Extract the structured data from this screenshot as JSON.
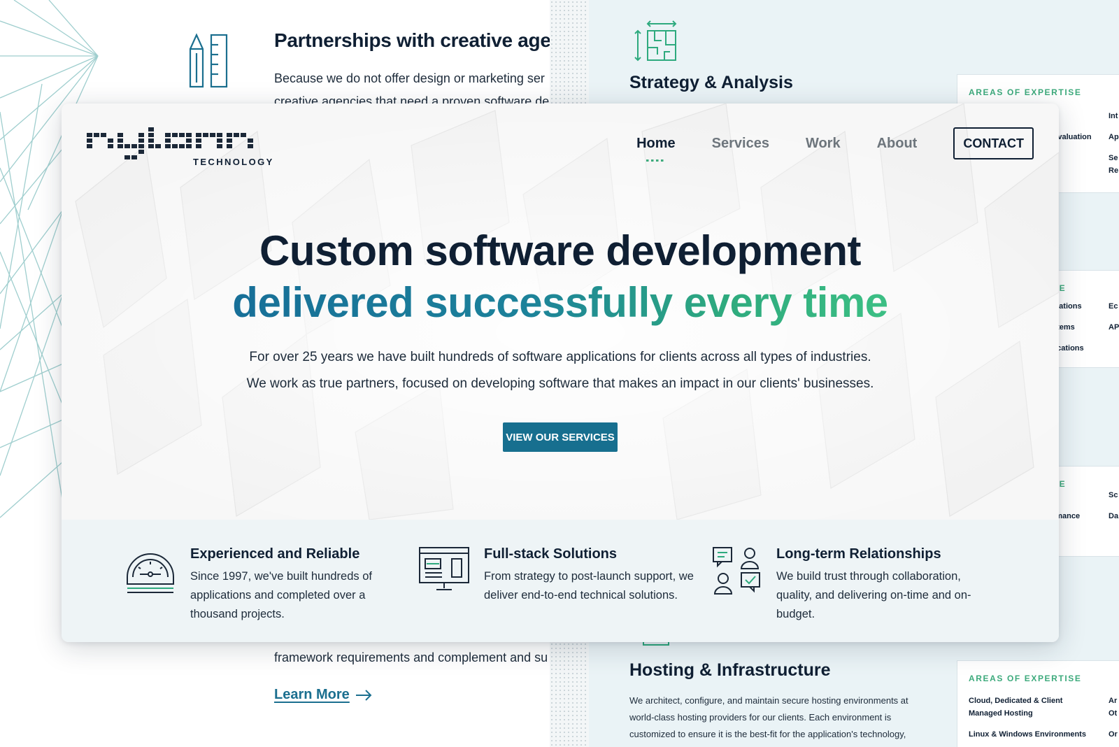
{
  "background_left": {
    "partner_title": "Partnerships with creative agen",
    "partner_text_1": "Because we do not offer design or marketing ser",
    "partner_text_2": "creative agencies that need a proven software de",
    "framework_text": "framework requirements and complement and su",
    "learn_more": "Learn More"
  },
  "background_right": {
    "strategy_title": "Strategy & Analysis",
    "hosting_title": "Hosting & Infrastructure",
    "hosting_text": "We architect, configure, and maintain secure hosting environments at world-class hosting providers for our clients. Each environment is customized to ensure it is the best-fit for the application's technology,",
    "cards": [
      {
        "label": "AREAS OF EXPERTISE",
        "items": [
          "Evaluation",
          "Int",
          "Ap",
          "Se",
          "Re"
        ]
      },
      {
        "label": "SE",
        "items": [
          "ications",
          "stems",
          "lications",
          "Ec",
          "AP"
        ]
      },
      {
        "label": "SE",
        "items": [
          "rmance",
          "Sc",
          "Da"
        ]
      },
      {
        "label": "AREAS OF EXPERTISE",
        "items": [
          "Cloud, Dedicated & Client",
          "Managed Hosting",
          "Linux & Windows Environments",
          "Ar",
          "Ot",
          "Or"
        ]
      }
    ]
  },
  "header": {
    "logo_sub": "TECHNOLOGY",
    "nav": [
      "Home",
      "Services",
      "Work",
      "About"
    ],
    "active_nav": "Home",
    "contact": "CONTACT"
  },
  "hero": {
    "headline_1": "Custom software development",
    "headline_2": "delivered successfully every time",
    "intro_1": "For over 25 years we have built hundreds of software applications for clients across all types of industries.",
    "intro_2": "We work as true partners, focused on developing software that makes an impact in our clients' businesses.",
    "cta": "VIEW OUR SERVICES"
  },
  "features": [
    {
      "icon": "gauge-icon",
      "title": "Experienced and Reliable",
      "text": "Since 1997, we've built hundreds of applications and completed over a thousand projects."
    },
    {
      "icon": "monitor-layout-icon",
      "title": "Full-stack Solutions",
      "text": "From strategy to post-launch support, we deliver end-to-end technical solutions."
    },
    {
      "icon": "people-chat-icon",
      "title": "Long-term Relationships",
      "text": "We build trust through collaboration, quality, and delivering on-time and on-budget."
    }
  ],
  "colors": {
    "navy": "#0f1f33",
    "teal": "#176f8f",
    "green": "#3daa7c",
    "light_bg": "#eef4f6"
  }
}
